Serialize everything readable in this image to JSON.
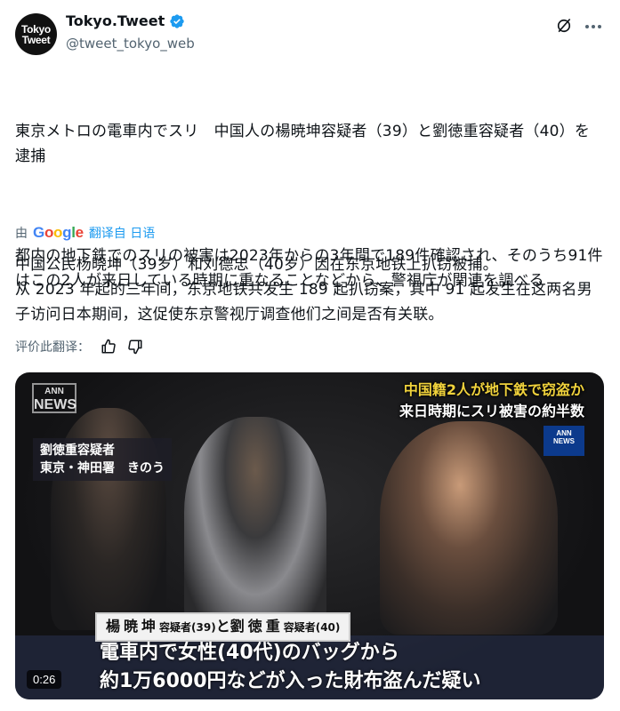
{
  "author": {
    "avatar_text_line1": "Tokyo",
    "avatar_text_line2": "Tweet",
    "display_name": "Tokyo.Tweet",
    "handle": "@tweet_tokyo_web",
    "verified": true
  },
  "icons": {
    "verified": "verified-badge-icon",
    "grok": "grok-icon",
    "more": "more-icon",
    "thumbs_up": "thumbs-up-icon",
    "thumbs_down": "thumbs-down-icon"
  },
  "tweet": {
    "paragraph1": "東京メトロの電車内でスリ　中国人の楊暁坤容疑者（39）と劉徳重容疑者（40）を逮捕",
    "paragraph2": "都内の地下鉄でのスリの被害は2023年からの3年間で189件確認され、そのうち91件はこの2人が来日している時期に重なることなどから、警視庁が関連を調べる"
  },
  "translation": {
    "by": "由",
    "google": [
      "G",
      "o",
      "o",
      "g",
      "l",
      "e"
    ],
    "translated_from": "翻译自 日语",
    "text": "中国公民杨晓坤（39岁）和刘德忠（40岁）因在东京地铁上扒窃被捕。\n从 2023 年起的三年间，东京地铁共发生 189 起扒窃案，其中 91 起发生在这两名男子访问日本期间，这促使东京警视厅调查他们之间是否有关联。",
    "rate_label": "评价此翻译："
  },
  "video": {
    "ann_logo_top": "ANN",
    "ann_logo_bottom": "NEWS",
    "caption_top_line1": "中国籍2人が地下鉄で窃盗か",
    "caption_top_line2": "来日時期にスリ被害の約半数",
    "ann_small_top": "ANN",
    "ann_small_bottom": "NEWS",
    "location_line1": "劉徳重容疑者",
    "location_line2": "東京・神田署　きのう",
    "names_bar": {
      "name1": "楊暁坤",
      "suffix1": "容疑者(39)",
      "conj": "と",
      "name2": "劉徳重",
      "suffix2": "容疑者(40)"
    },
    "caption_bottom_line1": "電車内で女性(40代)のバッグから",
    "caption_bottom_line2": "約1万6000円などが入った財布盗んだ疑い",
    "timestamp": "0:26"
  }
}
